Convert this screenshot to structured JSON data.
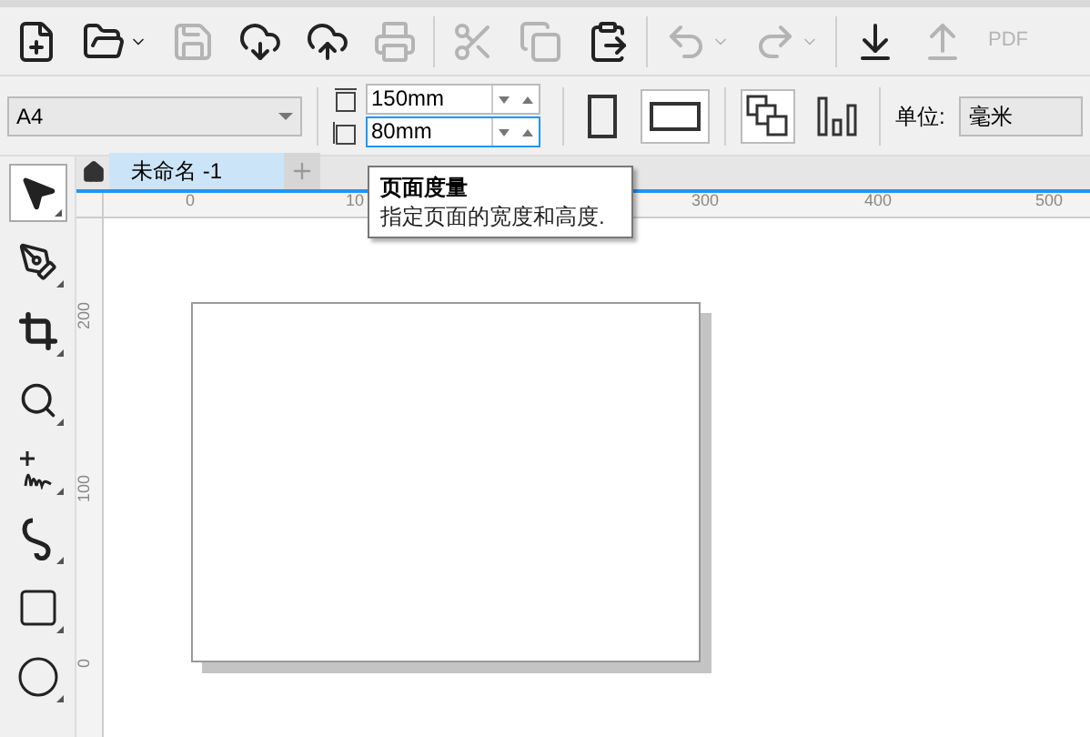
{
  "toolbar": {
    "buttons": [
      {
        "kind": "new",
        "disabled": false
      },
      {
        "kind": "open",
        "disabled": false
      },
      {
        "kind": "save",
        "disabled": true
      },
      {
        "kind": "cloud-download",
        "disabled": false
      },
      {
        "kind": "cloud-upload",
        "disabled": false
      },
      {
        "kind": "print",
        "disabled": true
      },
      {
        "kind": "cut",
        "disabled": true
      },
      {
        "kind": "copy",
        "disabled": true
      },
      {
        "kind": "paste",
        "disabled": false
      },
      {
        "kind": "undo",
        "disabled": true
      },
      {
        "kind": "redo",
        "disabled": true
      },
      {
        "kind": "import",
        "disabled": false
      },
      {
        "kind": "export",
        "disabled": true
      },
      {
        "kind": "pdf",
        "disabled": true,
        "label": "PDF"
      }
    ]
  },
  "property_bar": {
    "page_size": {
      "value": "A4"
    },
    "width": {
      "value": "150mm",
      "focused": false
    },
    "height": {
      "value": "80mm",
      "focused": true
    },
    "orientation": [
      {
        "kind": "portrait",
        "selected": false
      },
      {
        "kind": "landscape",
        "selected": true
      }
    ],
    "page_layout": [
      {
        "kind": "all-pages",
        "selected": true
      },
      {
        "kind": "current-page",
        "selected": false
      }
    ],
    "units": {
      "label": "单位:",
      "value": "毫米"
    }
  },
  "document_tabs": [
    {
      "label": "未命名 -1",
      "selected": true
    }
  ],
  "tooltip": {
    "title": "页面度量",
    "text": "指定页面的宽度和高度."
  },
  "rulers": {
    "horizontal": [
      {
        "label": "0"
      },
      {
        "label": "10"
      },
      {
        "label": "300"
      },
      {
        "label": "400"
      },
      {
        "label": "500"
      }
    ],
    "vertical": [
      {
        "label": "200"
      },
      {
        "label": "100"
      },
      {
        "label": "0"
      }
    ]
  },
  "tools": [
    {
      "kind": "pick",
      "selected": true
    },
    {
      "kind": "shape",
      "selected": false
    },
    {
      "kind": "crop",
      "selected": false
    },
    {
      "kind": "zoom",
      "selected": false
    },
    {
      "kind": "freehand",
      "selected": false
    },
    {
      "kind": "artistic",
      "selected": false
    },
    {
      "kind": "rectangle",
      "selected": false
    },
    {
      "kind": "ellipse",
      "selected": false
    }
  ]
}
